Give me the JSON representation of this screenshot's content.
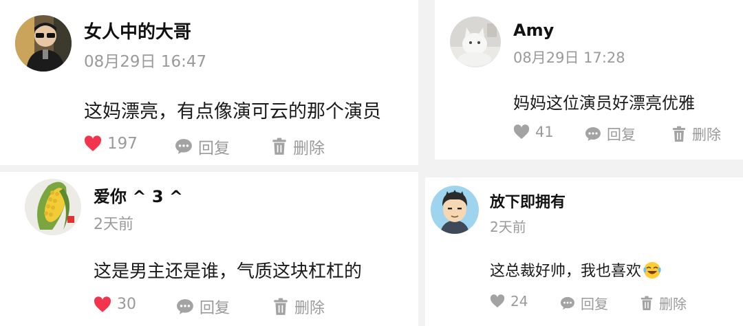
{
  "comments": [
    {
      "username": "女人中的大哥",
      "time": "08月29日 16:47",
      "text": "这妈漂亮，有点像演可云的那个演员",
      "likes": "197",
      "liked": true,
      "avatar": "avatar-man-sunglasses",
      "reply_label": "回复",
      "delete_label": "删除"
    },
    {
      "username": "Amy",
      "time": "08月29日 17:28",
      "text": "妈妈这位演员好漂亮优雅",
      "likes": "41",
      "liked": false,
      "avatar": "avatar-white-cat",
      "reply_label": "回复",
      "delete_label": "删除"
    },
    {
      "username": "爱你 ^ 3 ^",
      "time": "2天前",
      "text": "这是男主还是谁，气质这块杠杠的",
      "likes": "30",
      "liked": true,
      "avatar": "avatar-corn",
      "reply_label": "回复",
      "delete_label": "删除"
    },
    {
      "username": "放下即拥有",
      "time": "2天前",
      "text": "这总裁好帅，我也喜欢",
      "text_emoji": "laughing-tears-emoji",
      "likes": "24",
      "liked": false,
      "avatar": "avatar-cartoon-boy",
      "reply_label": "回复",
      "delete_label": "删除"
    }
  ],
  "colors": {
    "liked_heart": "#f2344d",
    "muted": "#9a9a9a",
    "text": "#1a1a1a"
  }
}
